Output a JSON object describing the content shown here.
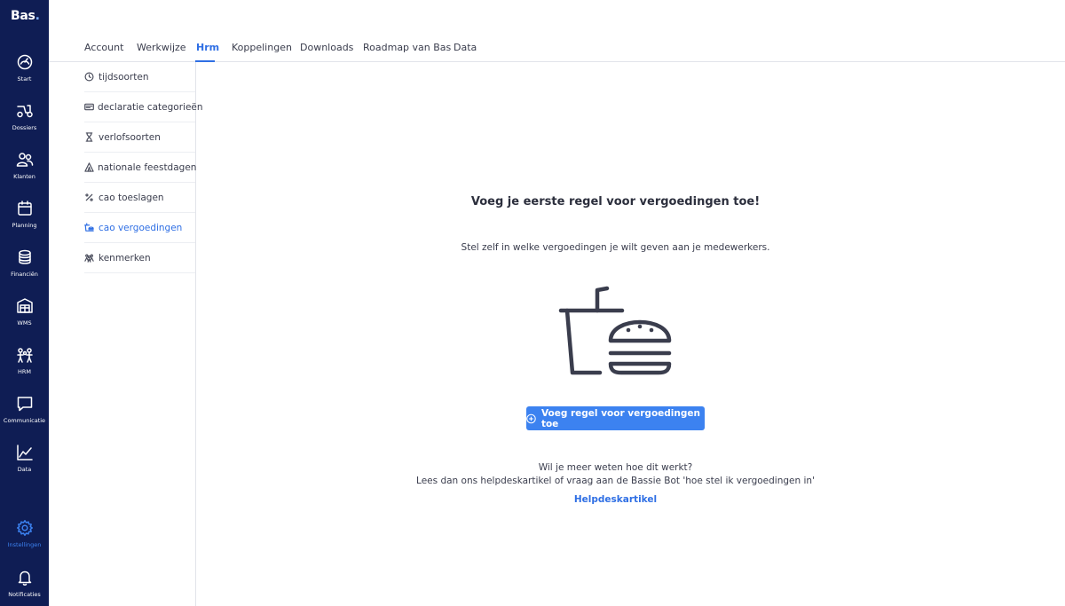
{
  "app": {
    "logo_text": "Bas",
    "logo_dot": "."
  },
  "sidebar": {
    "items": [
      {
        "label": "Start",
        "icon": "speedometer-icon"
      },
      {
        "label": "Dossiers",
        "icon": "scooter-icon"
      },
      {
        "label": "Klanten",
        "icon": "users-icon"
      },
      {
        "label": "Planning",
        "icon": "calendar-icon"
      },
      {
        "label": "Financiën",
        "icon": "coins-icon"
      },
      {
        "label": "WMS",
        "icon": "warehouse-icon"
      },
      {
        "label": "HRM",
        "icon": "team-icon"
      },
      {
        "label": "Communicatie",
        "icon": "chat-icon"
      },
      {
        "label": "Data",
        "icon": "chart-icon"
      },
      {
        "label": "Instellingen",
        "icon": "gear-icon",
        "active": true
      },
      {
        "label": "Notificaties",
        "icon": "bell-icon"
      }
    ]
  },
  "tabs": [
    {
      "label": "Account"
    },
    {
      "label": "Werkwijze"
    },
    {
      "label": "Hrm",
      "active": true
    },
    {
      "label": "Koppelingen"
    },
    {
      "label": "Downloads"
    },
    {
      "label": "Roadmap van Bas"
    },
    {
      "label": "Data"
    }
  ],
  "subnav": [
    {
      "label": "tijdsoorten",
      "icon": "clock-icon"
    },
    {
      "label": "declaratie categorieën",
      "icon": "receipt-icon"
    },
    {
      "label": "verlofsoorten",
      "icon": "hourglass-icon"
    },
    {
      "label": "nationale feestdagen",
      "icon": "tent-icon"
    },
    {
      "label": "cao toeslagen",
      "icon": "percent-icon"
    },
    {
      "label": "cao vergoedingen",
      "icon": "food-icon",
      "active": true
    },
    {
      "label": "kenmerken",
      "icon": "people-icon"
    }
  ],
  "main": {
    "title": "Voeg je eerste regel voor vergoedingen toe!",
    "subtitle": "Stel zelf in welke vergoedingen je wilt geven aan je medewerkers.",
    "illustration_icon": "drink-and-burger-icon",
    "button_label": "Voeg regel voor vergoedingen toe",
    "help_line1": "Wil je meer weten hoe dit werkt?",
    "help_line2": "Lees dan ons helpdeskartikel of vraag aan de Bassie Bot 'hoe stel ik vergoedingen in'",
    "help_link": "Helpdeskartikel"
  },
  "colors": {
    "sidebar_bg": "#0f1d54",
    "accent": "#3c82f0",
    "link": "#2f6fe4"
  }
}
